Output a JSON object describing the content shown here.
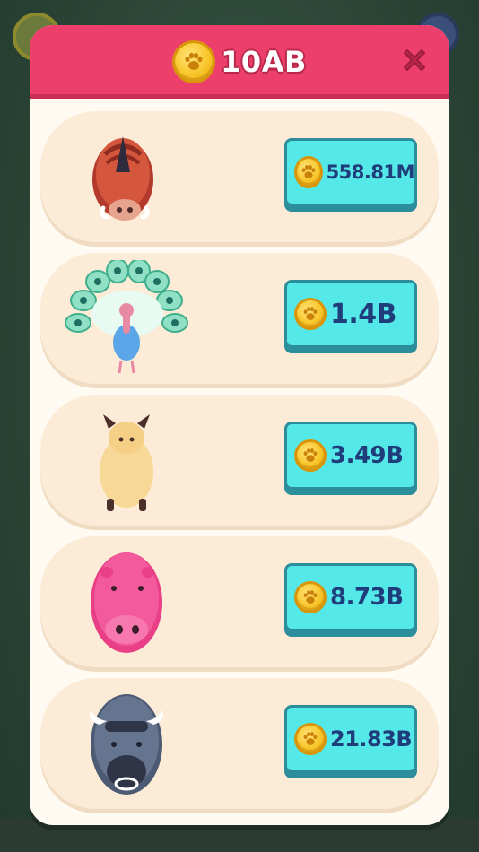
{
  "header": {
    "total": "10AB",
    "coin_icon": "paw-coin-icon",
    "close_icon": "close-icon"
  },
  "colors": {
    "header": "#ec3f6b",
    "card": "#fcecd7",
    "button": "#55e8e8",
    "price_text": "#1f3d7a"
  },
  "items": [
    {
      "animal": "boar",
      "price": "558.81M"
    },
    {
      "animal": "peacock",
      "price": "1.4B"
    },
    {
      "animal": "llama",
      "price": "3.49B"
    },
    {
      "animal": "hippo",
      "price": "8.73B"
    },
    {
      "animal": "buffalo",
      "price": "21.83B"
    }
  ]
}
